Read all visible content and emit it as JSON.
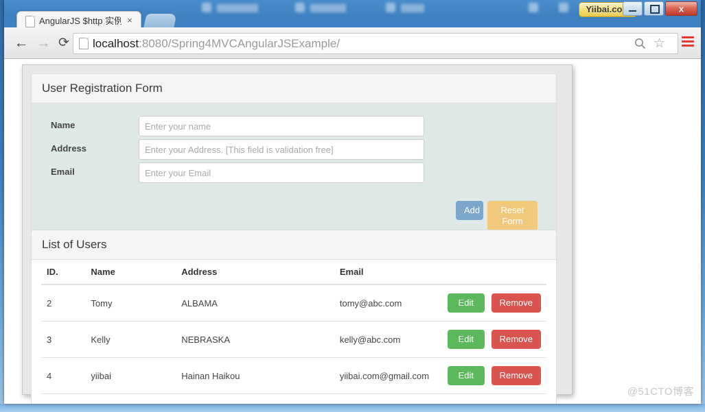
{
  "window": {
    "badge": "Yiibai.com",
    "minimize_label": "Minimize",
    "maximize_label": "Maximize",
    "close_label": "x"
  },
  "browser": {
    "tab": {
      "title": "AngularJS $http 实例",
      "close_label": "×"
    },
    "nav": {
      "back": "←",
      "forward": "→",
      "reload": "⟳"
    },
    "url": {
      "host": "localhost",
      "path": ":8080/Spring4MVCAngularJSExample/",
      "full": "localhost:8080/Spring4MVCAngularJSExample/"
    },
    "star": "☆"
  },
  "form_panel": {
    "title": "User Registration Form",
    "fields": [
      {
        "label": "Name",
        "placeholder": "Enter your name",
        "value": ""
      },
      {
        "label": "Address",
        "placeholder": "Enter your Address. [This field is validation free]",
        "value": ""
      },
      {
        "label": "Email",
        "placeholder": "Enter your Email",
        "value": ""
      }
    ],
    "add_label": "Add",
    "reset_label": "Reset Form"
  },
  "list_panel": {
    "title": "List of Users",
    "columns": [
      "ID.",
      "Name",
      "Address",
      "Email",
      ""
    ],
    "rows": [
      {
        "id": "2",
        "name": "Tomy",
        "address": "ALBAMA",
        "email": "tomy@abc.com",
        "edit": "Edit",
        "remove": "Remove"
      },
      {
        "id": "3",
        "name": "Kelly",
        "address": "NEBRASKA",
        "email": "kelly@abc.com",
        "edit": "Edit",
        "remove": "Remove"
      },
      {
        "id": "4",
        "name": "yiibai",
        "address": "Hainan Haikou",
        "email": "yiibai.com@gmail.com",
        "edit": "Edit",
        "remove": "Remove"
      }
    ]
  },
  "watermark": "@51CTO博客",
  "colors": {
    "add_button": "#7ba7cc",
    "reset_button": "#f0c97c",
    "edit_button": "#5cb85c",
    "remove_button": "#d9534f",
    "form_body": "#dfe9e7",
    "panel_heading": "#f5f5f5",
    "menu_icon": "#e23b2e"
  }
}
